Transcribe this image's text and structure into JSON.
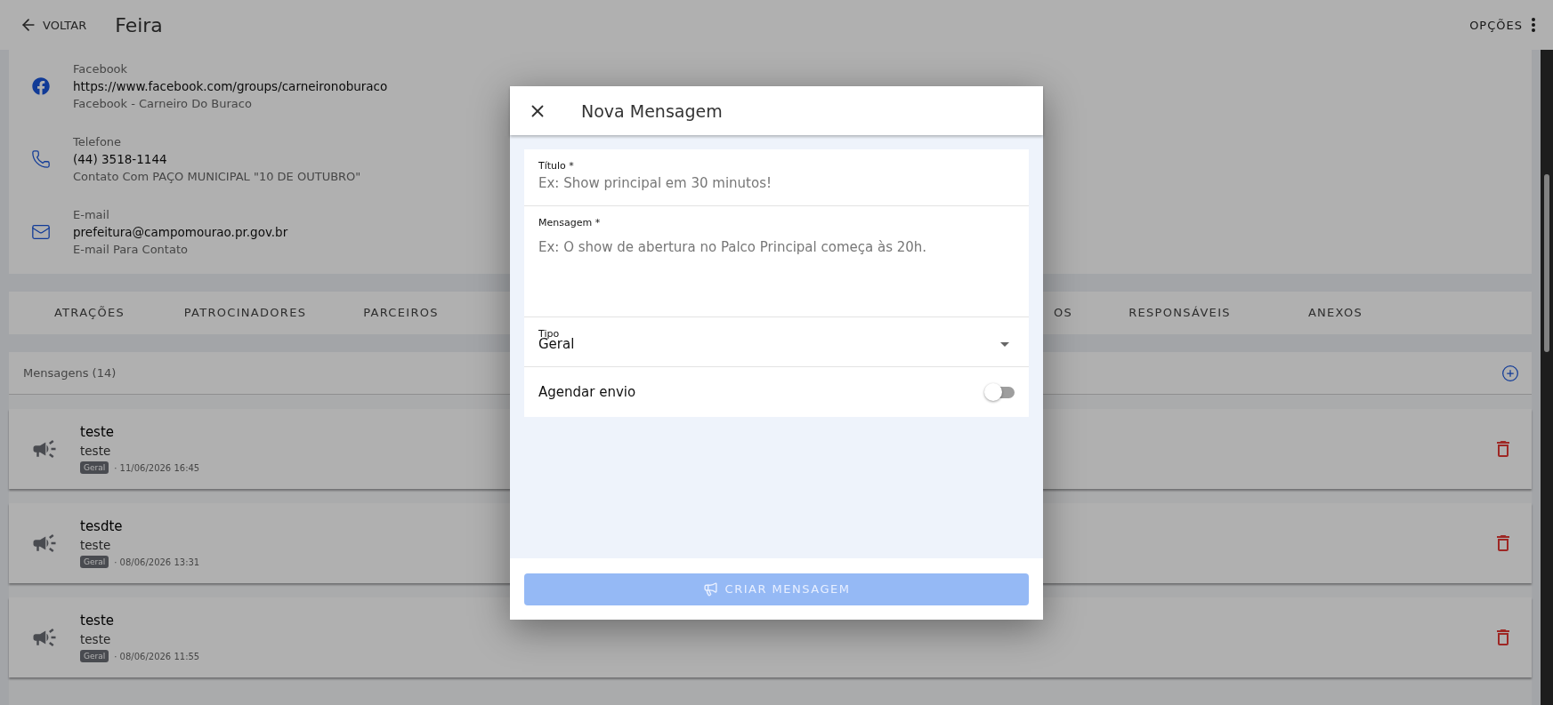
{
  "header": {
    "back_label": "VOLTAR",
    "title": "Feira",
    "options_label": "OPÇÕES"
  },
  "contacts": [
    {
      "kind": "facebook",
      "label": "Facebook",
      "value": "https://www.facebook.com/groups/carneironoburaco",
      "description": "Facebook - Carneiro Do Buraco"
    },
    {
      "kind": "phone",
      "label": "Telefone",
      "value": "(44) 3518-1144",
      "description": "Contato Com PAÇO MUNICIPAL \"10 DE OUTUBRO\""
    },
    {
      "kind": "email",
      "label": "E-mail",
      "value": "prefeitura@campomourao.pr.gov.br",
      "description": "E-mail Para Contato"
    }
  ],
  "tabs": [
    {
      "kind": "tab",
      "label": "ATRAÇÕES",
      "selected": false
    },
    {
      "kind": "tab",
      "label": "PATROCINADORES",
      "selected": false
    },
    {
      "kind": "tab",
      "label": "PARCEIROS",
      "selected": false
    },
    {
      "kind": "cut",
      "label": "OS",
      "selected": false
    },
    {
      "kind": "tab",
      "label": "RESPONSÁVEIS",
      "selected": false
    },
    {
      "kind": "tab",
      "label": "ANEXOS",
      "selected": false
    }
  ],
  "messages": {
    "title": "Mensagens (14)",
    "items": [
      {
        "title": "teste",
        "body": "teste",
        "tag": "Geral",
        "date": "· 11/06/2026 16:45"
      },
      {
        "title": "tesdte",
        "body": "teste",
        "tag": "Geral",
        "date": "· 08/06/2026 13:31"
      },
      {
        "title": "teste",
        "body": "teste",
        "tag": "Geral",
        "date": "· 08/06/2026 11:55"
      }
    ]
  },
  "dialog": {
    "title": "Nova Mensagem",
    "fields": [
      {
        "kind": "text",
        "label": "Título *",
        "placeholder": "Ex: Show principal em 30 minutos!"
      },
      {
        "kind": "textarea",
        "label": "Mensagem *",
        "placeholder": "Ex: O show de abertura no Palco Principal começa às 20h."
      },
      {
        "kind": "select",
        "label": "Tipo",
        "value": "Geral"
      },
      {
        "kind": "switch",
        "label": "Agendar envio",
        "on": false
      }
    ],
    "submit_label": "CRIAR MENSAGEM",
    "submit_disabled": true
  }
}
